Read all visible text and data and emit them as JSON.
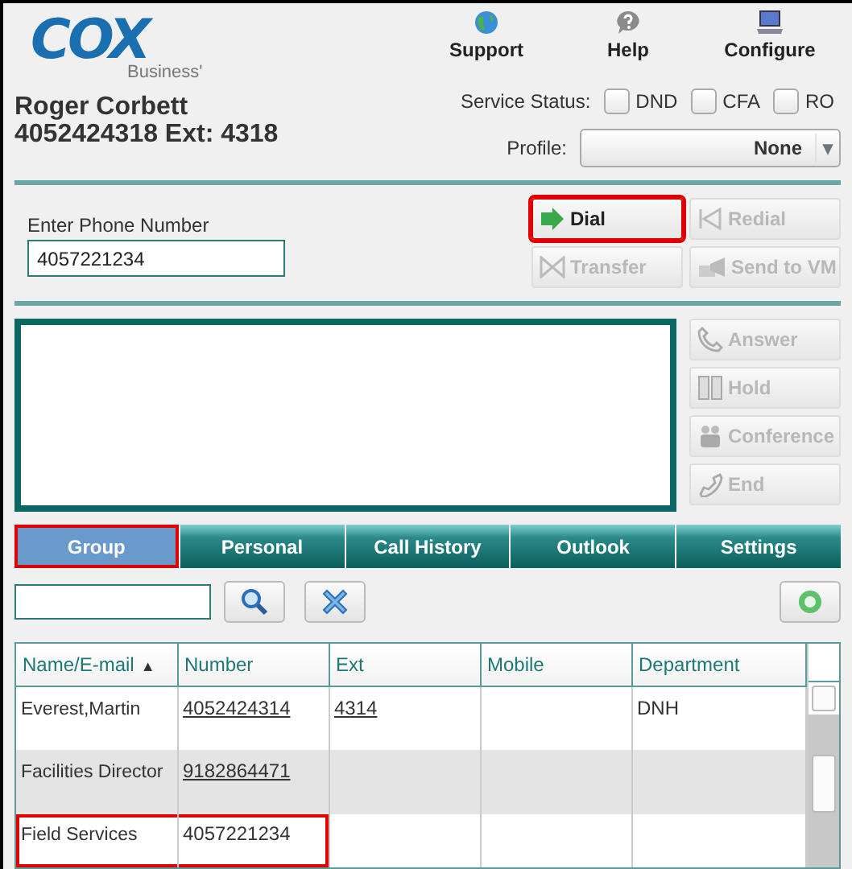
{
  "logo": {
    "wordmark": "COX",
    "tagline": "Business'"
  },
  "top_nav": [
    {
      "label": "Support",
      "kind": "globe"
    },
    {
      "label": "Help",
      "kind": "help"
    },
    {
      "label": "Configure",
      "kind": "laptop"
    }
  ],
  "user": {
    "name": "Roger Corbett",
    "line": "4052424318 Ext: 4318"
  },
  "service_status": {
    "label": "Service Status:",
    "options": [
      {
        "label": "DND",
        "checked": false
      },
      {
        "label": "CFA",
        "checked": false
      },
      {
        "label": "RO",
        "checked": false
      }
    ]
  },
  "profile": {
    "label": "Profile:",
    "value": "None",
    "caret": "▾"
  },
  "phone": {
    "label": "Enter Phone Number",
    "value": "4057221234"
  },
  "call_buttons": [
    {
      "label": "Dial",
      "kind": "dial",
      "disabled": false,
      "highlighted": true
    },
    {
      "label": "Redial",
      "kind": "redial",
      "disabled": true,
      "highlighted": false
    },
    {
      "label": "Transfer",
      "kind": "transfer",
      "disabled": true,
      "highlighted": false
    },
    {
      "label": "Send to VM",
      "kind": "voicemail",
      "disabled": true,
      "highlighted": false
    }
  ],
  "side_buttons": [
    {
      "label": "Answer",
      "kind": "answer",
      "disabled": true
    },
    {
      "label": "Hold",
      "kind": "hold",
      "disabled": true
    },
    {
      "label": "Conference",
      "kind": "conference",
      "disabled": true
    },
    {
      "label": "End",
      "kind": "end",
      "disabled": true
    }
  ],
  "tabs": [
    {
      "label": "Group",
      "selected": true,
      "highlighted": true
    },
    {
      "label": "Personal",
      "selected": false,
      "highlighted": false
    },
    {
      "label": "Call History",
      "selected": false,
      "highlighted": false
    },
    {
      "label": "Outlook",
      "selected": false,
      "highlighted": false
    },
    {
      "label": "Settings",
      "selected": false,
      "highlighted": false
    }
  ],
  "table": {
    "columns": [
      {
        "label": "Name/E-mail",
        "sorted": true,
        "sort_mark": "▲"
      },
      {
        "label": "Number",
        "sorted": false
      },
      {
        "label": "Ext",
        "sorted": false
      },
      {
        "label": "Mobile",
        "sorted": false
      },
      {
        "label": "Department",
        "sorted": false
      }
    ],
    "rows": [
      {
        "highlighted": false,
        "name": "Everest,Martin",
        "number": "4052424314",
        "number_linked": true,
        "ext": "4314",
        "ext_linked": true,
        "department": "DNH"
      },
      {
        "highlighted": false,
        "name": "Facilities Director",
        "number": "9182864471",
        "number_linked": true
      },
      {
        "highlighted": true,
        "name": "Field Services",
        "number": "4057221234",
        "number_linked": false
      }
    ]
  }
}
